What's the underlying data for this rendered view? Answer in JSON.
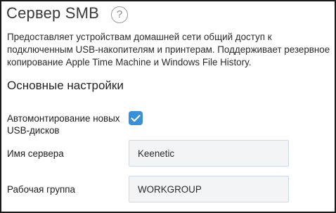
{
  "header": {
    "title": "Сервер SMB",
    "help_symbol": "?"
  },
  "description": "Предоставляет устройствам домашней сети общий доступ к подключенным USB-накопителям и принтерам. Поддерживает резервное копирование Apple Time Machine и Windows File History.",
  "section_title": "Основные настройки",
  "settings": {
    "automount": {
      "label": "Автомонтирование новых USB-дисков",
      "checked": true
    },
    "server_name": {
      "label": "Имя сервера",
      "value": "Keenetic"
    },
    "workgroup": {
      "label": "Рабочая группа",
      "value": "WORKGROUP"
    }
  },
  "colors": {
    "accent": "#3a8fd9",
    "field_border": "#c9d9ea",
    "field_bg": "#f3f4f6"
  }
}
